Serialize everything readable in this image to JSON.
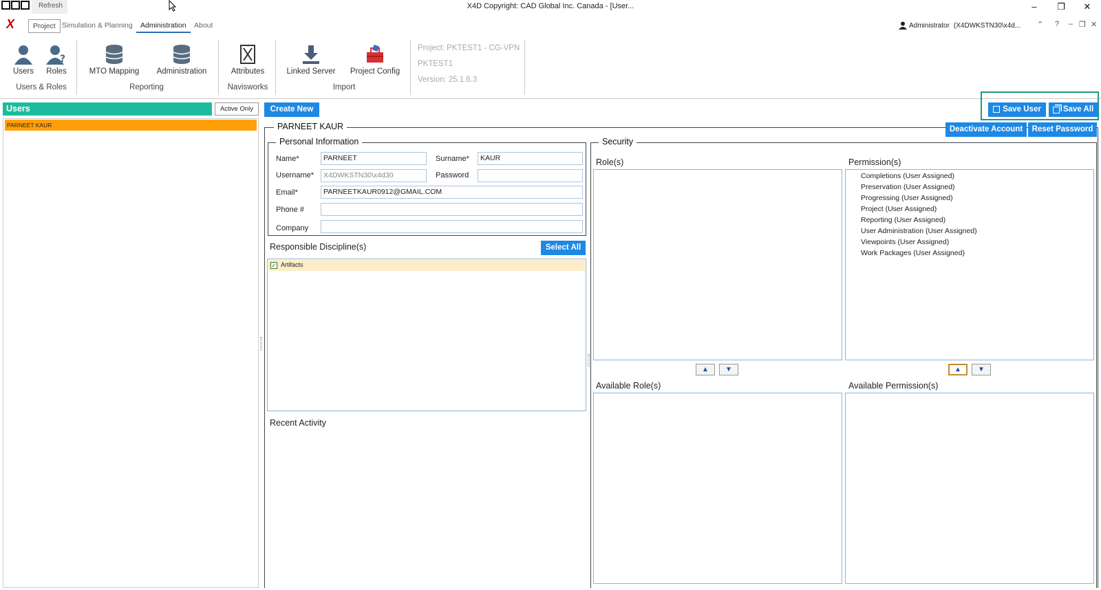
{
  "titlebar": {
    "refresh_label": "Refresh",
    "title": "X4D Copyright: CAD Global Inc. Canada - [User...",
    "minimize": "–",
    "restore": "❐",
    "close": "✕"
  },
  "tabs": {
    "project": "Project",
    "simulation": "Simulation & Planning",
    "administration": "Administration",
    "about": "About"
  },
  "user": {
    "name": "Administrator",
    "machine": "(X4DWKSTN30\\x4d..."
  },
  "ribbon": {
    "users": "Users",
    "roles": "Roles",
    "group_users_roles": "Users & Roles",
    "mto_mapping": "MTO Mapping",
    "administration": "Administration",
    "group_reporting": "Reporting",
    "attributes": "Attributes",
    "group_navisworks": "Navisworks",
    "linked_server": "Linked Server",
    "project_config": "Project Config",
    "group_import": "Import",
    "project_line": "Project: PKTEST1 - CG-VPN",
    "project_code": "PKTEST1",
    "version": "Version: 25.1.6.3"
  },
  "left": {
    "header": "Users",
    "active_only": "Active Only",
    "users": [
      "PARNEET KAUR"
    ]
  },
  "actions": {
    "create_new": "Create New",
    "save_user": "Save User",
    "save_all": "Save All",
    "deactivate": "Deactivate Account",
    "reset_password": "Reset Password",
    "select_all": "Select All"
  },
  "detail": {
    "user_title": "PARNEET KAUR",
    "personal_info": "Personal Information",
    "name_label": "Name*",
    "name_value": "PARNEET",
    "surname_label": "Surname*",
    "surname_value": "KAUR",
    "username_label": "Username*",
    "username_value": "X4DWKSTN30\\x4d30",
    "password_label": "Password",
    "password_value": "",
    "email_label": "Email*",
    "email_value": "PARNEETKAUR0912@GMAIL.COM",
    "phone_label": "Phone #",
    "phone_value": "",
    "company_label": "Company",
    "company_value": "",
    "disciplines_title": "Responsible Discipline(s)",
    "disciplines": [
      "Artifacts"
    ],
    "recent_activity": "Recent Activity"
  },
  "security": {
    "title": "Security",
    "roles_title": "Role(s)",
    "permissions_title": "Permission(s)",
    "available_roles_title": "Available Role(s)",
    "available_permissions_title": "Available Permission(s)",
    "permissions": [
      "Completions (User Assigned)",
      "Preservation (User Assigned)",
      "Progressing (User Assigned)",
      "Project (User Assigned)",
      "Reporting (User Assigned)",
      "User Administration (User Assigned)",
      "Viewpoints (User Assigned)",
      "Work Packages (User Assigned)"
    ],
    "up": "▲",
    "down": "▼"
  }
}
